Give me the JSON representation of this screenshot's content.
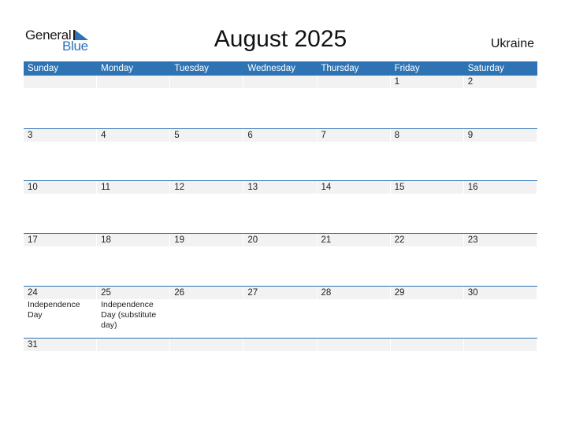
{
  "logo": {
    "word1": "General",
    "word2": "Blue",
    "icon": "triangle-flag-icon"
  },
  "title": "August 2025",
  "country": "Ukraine",
  "colors": {
    "accent": "#2e74b5",
    "band": "#f2f2f2",
    "logo_blue": "#2a73b8"
  },
  "weekdays": [
    "Sunday",
    "Monday",
    "Tuesday",
    "Wednesday",
    "Thursday",
    "Friday",
    "Saturday"
  ],
  "weeks": [
    {
      "days": [
        {
          "num": ""
        },
        {
          "num": ""
        },
        {
          "num": ""
        },
        {
          "num": ""
        },
        {
          "num": ""
        },
        {
          "num": "1"
        },
        {
          "num": "2"
        }
      ]
    },
    {
      "days": [
        {
          "num": "3"
        },
        {
          "num": "4"
        },
        {
          "num": "5"
        },
        {
          "num": "6"
        },
        {
          "num": "7"
        },
        {
          "num": "8"
        },
        {
          "num": "9"
        }
      ]
    },
    {
      "days": [
        {
          "num": "10"
        },
        {
          "num": "11"
        },
        {
          "num": "12"
        },
        {
          "num": "13"
        },
        {
          "num": "14"
        },
        {
          "num": "15"
        },
        {
          "num": "16"
        }
      ]
    },
    {
      "days": [
        {
          "num": "17"
        },
        {
          "num": "18"
        },
        {
          "num": "19"
        },
        {
          "num": "20"
        },
        {
          "num": "21"
        },
        {
          "num": "22"
        },
        {
          "num": "23"
        }
      ]
    },
    {
      "days": [
        {
          "num": "24",
          "holiday": "Independence Day"
        },
        {
          "num": "25",
          "holiday": "Independence Day (substitute day)"
        },
        {
          "num": "26"
        },
        {
          "num": "27"
        },
        {
          "num": "28"
        },
        {
          "num": "29"
        },
        {
          "num": "30"
        }
      ]
    },
    {
      "days": [
        {
          "num": "31"
        },
        {
          "num": ""
        },
        {
          "num": ""
        },
        {
          "num": ""
        },
        {
          "num": ""
        },
        {
          "num": ""
        },
        {
          "num": ""
        }
      ]
    }
  ]
}
